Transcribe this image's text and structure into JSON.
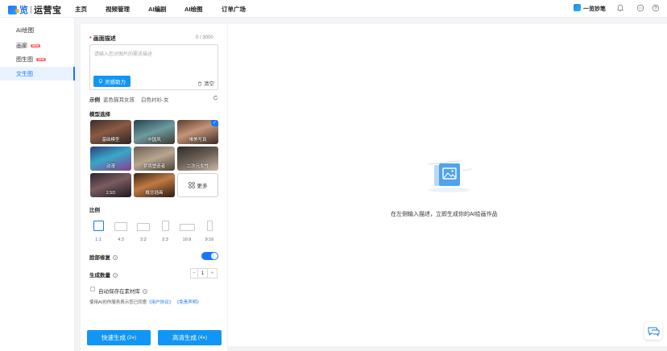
{
  "header": {
    "brand": "览",
    "app_name": "运营宝",
    "nav": [
      "主页",
      "视频管理",
      "AI编剧",
      "AI绘图",
      "订单广场"
    ],
    "pen_label": "一览妙笔",
    "icons": [
      "bell-icon",
      "message-icon",
      "help-icon"
    ]
  },
  "sidebar": {
    "title": "AI绘图",
    "items": [
      {
        "label": "画廊",
        "badge": "NEW"
      },
      {
        "label": "图生图",
        "badge": "NEW"
      },
      {
        "label": "文生图",
        "badge": ""
      }
    ]
  },
  "form": {
    "desc_label": "画面描述",
    "counter": "0 / 3000",
    "placeholder": "请输入您对图片的需求描述",
    "inspire_button": "灵感助力",
    "clear_button": "清空",
    "example_label": "示例",
    "examples": [
      "蓝色猫耳女孩",
      "白色衬衫-女"
    ],
    "model_label": "模型选择",
    "models": [
      "基础模型",
      "中国风",
      "唯美写真",
      "动漫",
      "梦境塑造者",
      "二次元女性",
      "2.5D",
      "概念插画"
    ],
    "more_button": "更多",
    "ratio_label": "比例",
    "ratios": [
      "1:1",
      "4:3",
      "3:2",
      "2:3",
      "16:9",
      "9:16"
    ],
    "face_fix_label": "脸部修复",
    "count_label": "生成数量",
    "count_value": "1",
    "count_minus": "−",
    "count_plus": "+",
    "autosave_label": "自动保存在素材库",
    "terms_prefix": "使用AI创作服务表示您已同意",
    "terms_user": "《用户协议》",
    "terms_disclaimer": "《免责声明》",
    "fast_button": "快速生成",
    "fast_cost": "(2",
    "hd_button": "高清生成",
    "hd_cost": "(4",
    "cost_suffix": ")"
  },
  "result": {
    "empty_text": "在左侧输入描述，立即生成你的AI绘画作品"
  },
  "colors": {
    "primary": "#1677ff",
    "button": "#1296f5",
    "badge": "#ff5a5a",
    "required": "#f53f3f"
  }
}
